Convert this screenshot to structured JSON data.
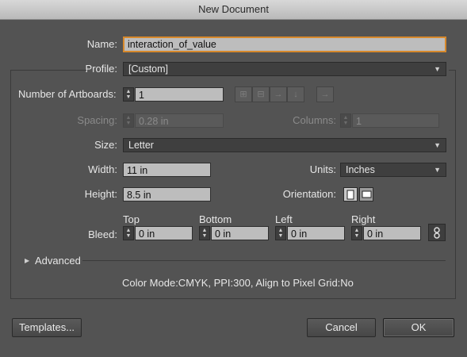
{
  "window": {
    "title": "New Document"
  },
  "name": {
    "label": "Name:",
    "value": "interaction_of_value"
  },
  "profile": {
    "label": "Profile:",
    "value": "[Custom]"
  },
  "artboards": {
    "label": "Number of Artboards:",
    "value": "1"
  },
  "spacing": {
    "label": "Spacing:",
    "value": "0.28 in"
  },
  "columns": {
    "label": "Columns:",
    "value": "1"
  },
  "size": {
    "label": "Size:",
    "value": "Letter"
  },
  "width": {
    "label": "Width:",
    "value": "11 in"
  },
  "units": {
    "label": "Units:",
    "value": "Inches"
  },
  "height": {
    "label": "Height:",
    "value": "8.5 in"
  },
  "orientation": {
    "label": "Orientation:",
    "selected": "landscape"
  },
  "bleed": {
    "label": "Bleed:",
    "top": {
      "label": "Top",
      "value": "0 in"
    },
    "bottom": {
      "label": "Bottom",
      "value": "0 in"
    },
    "left": {
      "label": "Left",
      "value": "0 in"
    },
    "right": {
      "label": "Right",
      "value": "0 in"
    }
  },
  "advanced": {
    "label": "Advanced"
  },
  "summary": "Color Mode:CMYK, PPI:300, Align to Pixel Grid:No",
  "buttons": {
    "templates": "Templates...",
    "cancel": "Cancel",
    "ok": "OK"
  },
  "icons": {
    "artboard_layout": [
      "grid-by-row-icon",
      "grid-by-column-icon",
      "arrange-by-row-icon",
      "arrange-by-column-icon"
    ],
    "direction": "right-to-left-arrow-icon",
    "link": "chain-link-icon"
  },
  "colors": {
    "focus": "#d7892c",
    "background": "#535353"
  }
}
